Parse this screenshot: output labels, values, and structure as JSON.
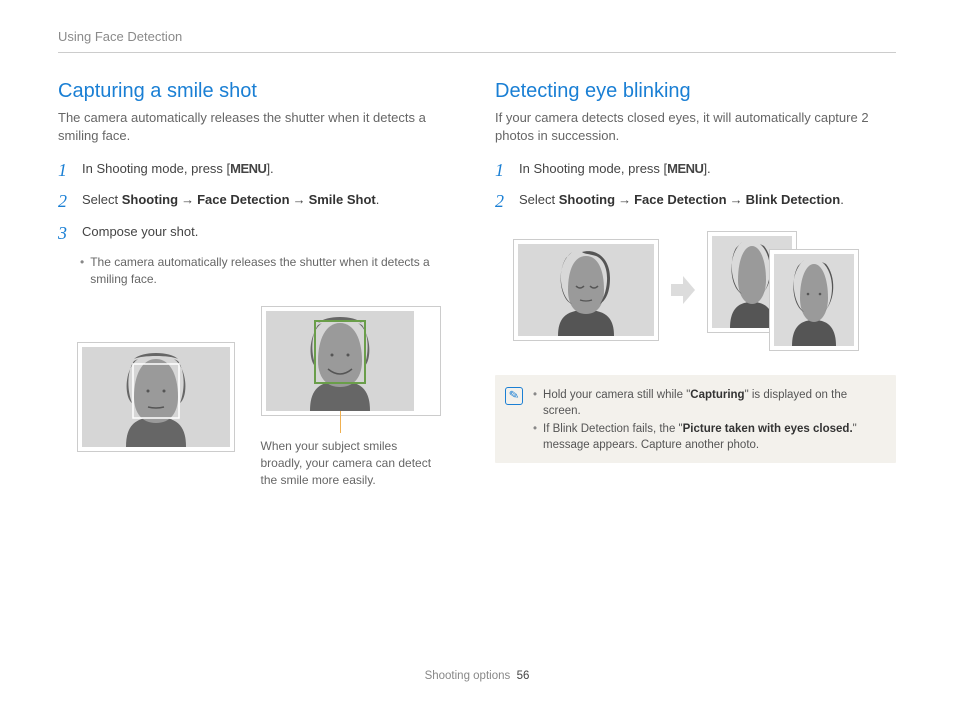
{
  "breadcrumb": "Using Face Detection",
  "left": {
    "heading": "Capturing a smile shot",
    "intro": "The camera automatically releases the shutter when it detects a smiling face.",
    "step1_prefix": "In Shooting mode, press [",
    "step1_key": "MENU",
    "step1_suffix": "].",
    "step2_prefix": "Select ",
    "step2_a": "Shooting",
    "step2_b": "Face Detection",
    "step2_c": "Smile Shot",
    "arrow": "→",
    "period": ".",
    "step3": "Compose your shot.",
    "bullet": "The camera automatically releases the shutter when it detects a smiling face.",
    "caption": "When your subject smiles broadly, your camera can detect the smile more easily."
  },
  "right": {
    "heading": "Detecting eye blinking",
    "intro": "If your camera detects closed eyes, it will automatically capture 2 photos in succession.",
    "step1_prefix": "In Shooting mode, press [",
    "step1_key": "MENU",
    "step1_suffix": "].",
    "step2_prefix": "Select ",
    "step2_a": "Shooting",
    "step2_b": "Face Detection",
    "step2_c": "Blink Detection",
    "arrow": "→",
    "period": ".",
    "tip1_pre": "Hold your camera still while \"",
    "tip1_bold": "Capturing",
    "tip1_post": "\" is displayed on the screen.",
    "tip2_pre": "If Blink Detection fails, the \"",
    "tip2_bold": "Picture taken with eyes closed.",
    "tip2_post": "\" message appears. Capture another photo."
  },
  "footer": {
    "label": "Shooting options",
    "page": "56"
  }
}
